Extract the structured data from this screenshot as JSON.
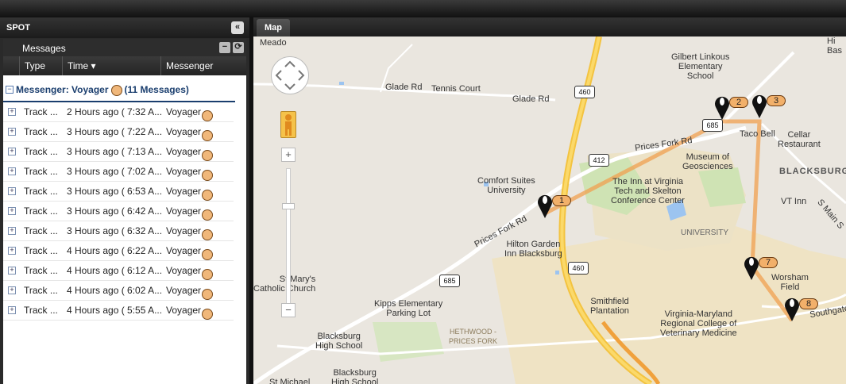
{
  "panel": {
    "title": "SPOT",
    "collapse_icon": "«",
    "subheader": "Messages",
    "minus_icon": "−",
    "refresh_icon": "⟳",
    "columns": [
      "Type",
      "Time ▾",
      "Messenger"
    ]
  },
  "group": {
    "toggle": "−",
    "label_prefix": "Messenger: Voyager",
    "label_suffix": "(11 Messages)"
  },
  "rows": [
    {
      "type": "Track ...",
      "time": "2 Hours ago ( 7:32 A...",
      "messenger": "Voyager"
    },
    {
      "type": "Track ...",
      "time": "3 Hours ago ( 7:22 A...",
      "messenger": "Voyager"
    },
    {
      "type": "Track ...",
      "time": "3 Hours ago ( 7:13 A...",
      "messenger": "Voyager"
    },
    {
      "type": "Track ...",
      "time": "3 Hours ago ( 7:02 A...",
      "messenger": "Voyager"
    },
    {
      "type": "Track ...",
      "time": "3 Hours ago ( 6:53 A...",
      "messenger": "Voyager"
    },
    {
      "type": "Track ...",
      "time": "3 Hours ago ( 6:42 A...",
      "messenger": "Voyager"
    },
    {
      "type": "Track ...",
      "time": "3 Hours ago ( 6:32 A...",
      "messenger": "Voyager"
    },
    {
      "type": "Track ...",
      "time": "4 Hours ago ( 6:22 A...",
      "messenger": "Voyager"
    },
    {
      "type": "Track ...",
      "time": "4 Hours ago ( 6:12 A...",
      "messenger": "Voyager"
    },
    {
      "type": "Track ...",
      "time": "4 Hours ago ( 6:02 A...",
      "messenger": "Voyager"
    },
    {
      "type": "Track ...",
      "time": "4 Hours ago ( 5:55 A...",
      "messenger": "Voyager"
    }
  ],
  "map": {
    "tab": "Map",
    "zoom_in": "+",
    "zoom_out": "−",
    "markers": [
      "1",
      "2",
      "3",
      "7",
      "8"
    ],
    "shields": [
      "460",
      "460",
      "412",
      "685",
      "685"
    ],
    "labels": {
      "meadow": "Meado",
      "glade1": "Glade Rd",
      "tennis": "Tennis Court",
      "glade2": "Glade Rd",
      "gilbert": "Gilbert Linkous\nElementary\nSchool",
      "hi": "Hi\nBas",
      "tacobell": "Taco Bell",
      "cellar": "Cellar\nRestaurant",
      "blacksburg": "BLACKSBURG",
      "pricesfork1": "Prices Fork Rd",
      "pricesfork2": "Prices Fork Rd",
      "museum": "Museum of\nGeosciences",
      "inn": "The Inn at Virginia\nTech and Skelton\nConference Center",
      "comfort": "Comfort Suites\nUniversity",
      "vtinn": "VT Inn",
      "smain": "S Main S",
      "university": "UNIVERSITY",
      "hilton": "Hilton Garden\nInn Blacksburg",
      "stmarys": "St Mary's\nCatholic Church",
      "worsham": "Worsham\nField",
      "southgate": "Southgate D",
      "kipps": "Kipps Elementary\nParking Lot",
      "smithfield": "Smithfield\nPlantation",
      "vmrcvm": "Virginia-Maryland\nRegional College of\nVeterinary Medicine",
      "hethwood": "HETHWOOD -\nPRICES FORK",
      "bhs1": "Blacksburg\nHigh School",
      "bhs2": "Blacksburg\nHigh School",
      "stmichael": "St Michael"
    }
  }
}
